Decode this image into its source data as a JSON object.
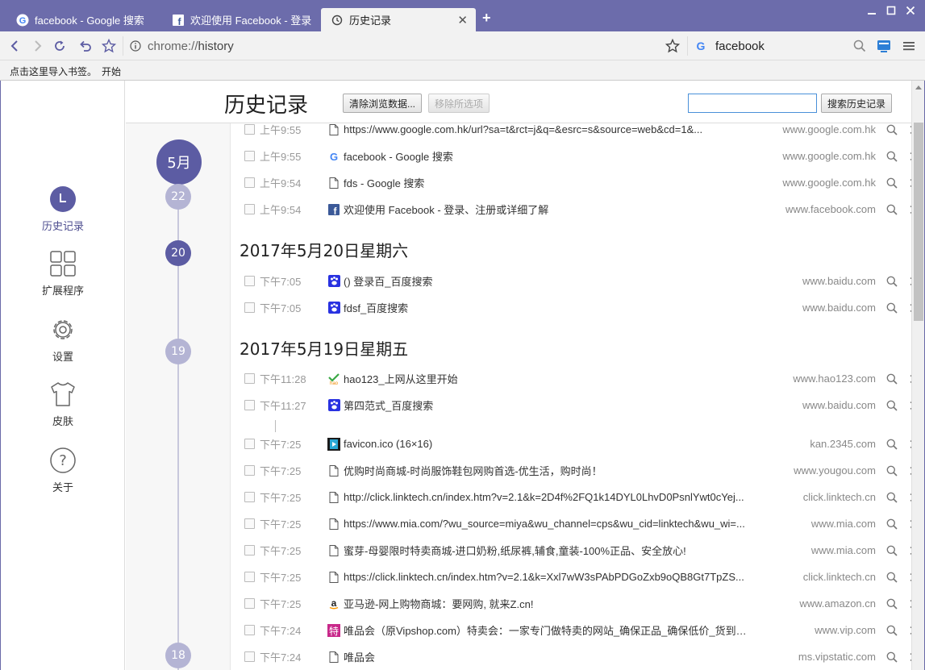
{
  "tabs": [
    {
      "title": "facebook - Google 搜索",
      "icon": "google-icon"
    },
    {
      "title": "欢迎使用 Facebook - 登录、",
      "icon": "facebook-icon"
    },
    {
      "title": "历史记录",
      "icon": "history-icon"
    }
  ],
  "new_tab_symbol": "+",
  "address": {
    "scheme": "chrome://",
    "path": "history"
  },
  "search_box": {
    "value": "facebook",
    "engine_icon": "google-icon"
  },
  "bookmark_bar": {
    "prompt": "点击这里导入书签。",
    "start_link": "开始"
  },
  "sidebar": {
    "items": [
      {
        "label": "历史记录",
        "icon": "history-icon",
        "active": true
      },
      {
        "label": "扩展程序",
        "icon": "extensions-icon"
      },
      {
        "label": "设置",
        "icon": "gear-icon"
      },
      {
        "label": "皮肤",
        "icon": "shirt-icon"
      },
      {
        "label": "关于",
        "icon": "help-icon"
      }
    ]
  },
  "header": {
    "title": "历史记录",
    "clear_button": "清除浏览数据...",
    "remove_button": "移除所选项",
    "search_value": "",
    "search_button": "搜索历史记录"
  },
  "timeline": {
    "month": "5月",
    "days": [
      "22",
      "20",
      "19",
      "18"
    ]
  },
  "groups": [
    {
      "date": "",
      "rows": [
        {
          "time": "上午9:55",
          "icon": "page-icon",
          "title": "https://www.google.com.hk/url?sa=t&rct=j&q=&esrc=s&source=web&cd=1&...",
          "domain": "www.google.com.hk"
        },
        {
          "time": "上午9:55",
          "icon": "google-icon",
          "title": "facebook - Google 搜索",
          "domain": "www.google.com.hk"
        },
        {
          "time": "上午9:54",
          "icon": "page-icon",
          "title": "fds - Google 搜索",
          "domain": "www.google.com.hk"
        },
        {
          "time": "上午9:54",
          "icon": "facebook-icon",
          "title": "欢迎使用 Facebook - 登录、注册或详细了解",
          "domain": "www.facebook.com"
        }
      ]
    },
    {
      "date": "2017年5月20日星期六",
      "rows": [
        {
          "time": "下午7:05",
          "icon": "baidu-icon",
          "title": "() 登录百_百度搜索",
          "domain": "www.baidu.com"
        },
        {
          "time": "下午7:05",
          "icon": "baidu-icon",
          "title": "fdsf_百度搜索",
          "domain": "www.baidu.com"
        }
      ]
    },
    {
      "date": "2017年5月19日星期五",
      "rows": [
        {
          "time": "下午11:28",
          "icon": "hao123-icon",
          "title": "hao123_上网从这里开始",
          "domain": "www.hao123.com"
        },
        {
          "time": "下午11:27",
          "icon": "baidu-icon",
          "title": "第四范式_百度搜索",
          "domain": "www.baidu.com"
        },
        {
          "time": "下午7:25",
          "icon": "film-icon",
          "title": "favicon.ico (16×16)",
          "domain": "kan.2345.com"
        },
        {
          "time": "下午7:25",
          "icon": "page-icon",
          "title": "优购时尚商城-时尚服饰鞋包网购首选-优生活，购时尚！",
          "domain": "www.yougou.com"
        },
        {
          "time": "下午7:25",
          "icon": "page-icon",
          "title": "http://click.linktech.cn/index.htm?v=2.1&k=2D4f%2FQ1k14DYL0LhvD0PsnlYwt0cYej...",
          "domain": "click.linktech.cn"
        },
        {
          "time": "下午7:25",
          "icon": "page-icon",
          "title": "https://www.mia.com/?wu_source=miya&wu_channel=cps&wu_cid=linktech&wu_wi=...",
          "domain": "www.mia.com"
        },
        {
          "time": "下午7:25",
          "icon": "page-icon",
          "title": "蜜芽-母婴限时特卖商城-进口奶粉,纸尿裤,辅食,童装-100%正品、安全放心!",
          "domain": "www.mia.com"
        },
        {
          "time": "下午7:25",
          "icon": "page-icon",
          "title": "https://click.linktech.cn/index.htm?v=2.1&k=Xxl7wW3sPAbPDGoZxb9oQB8Gt7TpZS...",
          "domain": "click.linktech.cn"
        },
        {
          "time": "下午7:25",
          "icon": "amazon-icon",
          "title": "亚马逊-网上购物商城：要网购, 就来Z.cn!",
          "domain": "www.amazon.cn"
        },
        {
          "time": "下午7:24",
          "icon": "vip-icon",
          "title": "唯品会（原Vipshop.com）特卖会：一家专门做特卖的网站_确保正品_确保低价_货到付...",
          "domain": "www.vip.com"
        },
        {
          "time": "下午7:24",
          "icon": "page-icon",
          "title": "唯品会",
          "domain": "ms.vipstatic.com"
        }
      ]
    }
  ],
  "colors": {
    "accent": "#5c5ca3",
    "titlebar": "#6c6cab",
    "timeline_light": "#b4b4d4"
  }
}
